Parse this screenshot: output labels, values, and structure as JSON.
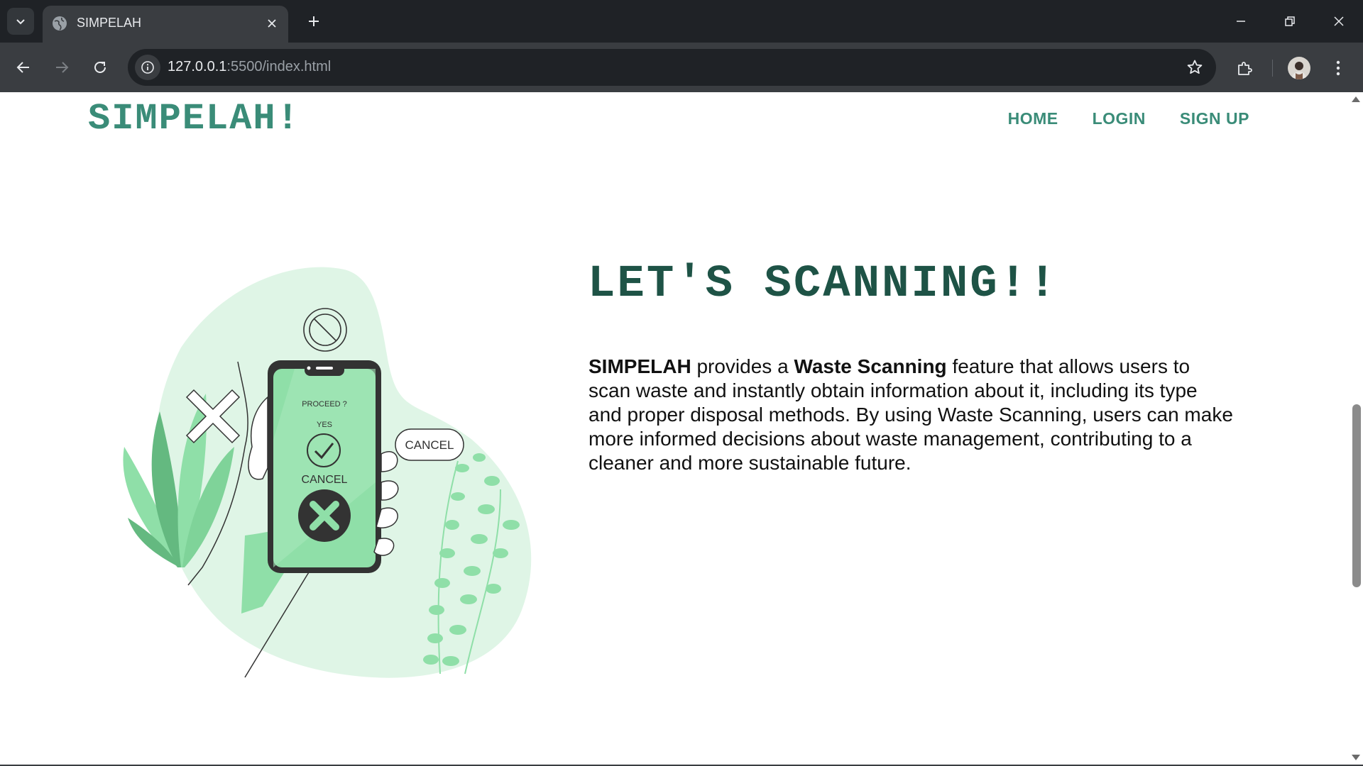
{
  "browser": {
    "tab_title": "SIMPELAH",
    "url_host": "127.0.0.1",
    "url_rest": ":5500/index.html",
    "icons": [
      "tab-list-icon",
      "globe-icon",
      "close-icon",
      "plus-icon",
      "minimize-icon",
      "restore-icon",
      "close-window-icon",
      "back-icon",
      "forward-icon",
      "reload-icon",
      "site-info-icon",
      "star-icon",
      "extensions-icon",
      "avatar",
      "kebab-menu-icon"
    ]
  },
  "page": {
    "brand": "SIMPELAH!",
    "nav": {
      "home": "HOME",
      "login": "LOGIN",
      "signup": "SIGN UP"
    },
    "hero": {
      "title": "LET'S SCANNING!!",
      "p1_bold": "SIMPELAH",
      "p1_a": " provides a ",
      "p1_bold2": "Waste Scanning",
      "p1_b": " feature that allows users to scan waste and instantly obtain information about it, including its type and proper disposal methods. By using Waste Scanning, users can make more informed decisions about waste management, contributing to a cleaner and more sustainable future."
    },
    "illustration": {
      "phone_prompt": "PROCEED ?",
      "phone_yes": "YES",
      "phone_cancel": "CANCEL",
      "bubble_cancel": "CANCEL"
    },
    "colors": {
      "brand": "#3a8c78",
      "title": "#1e5346",
      "blob": "#dff5e6",
      "leaf": "#8fdfa8",
      "leaf_dark": "#64b980"
    }
  }
}
